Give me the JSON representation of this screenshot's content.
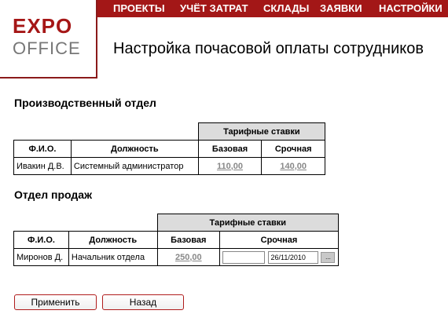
{
  "logo": {
    "line1": "EXPO",
    "line2": "OFFICE"
  },
  "nav": [
    "ПРОЕКТЫ",
    "УЧЁТ ЗАТРАТ",
    "СКЛАДЫ",
    "ЗАЯВКИ",
    "НАСТРОЙКИ"
  ],
  "page_title": "Настройка почасовой оплаты сотрудников",
  "production": {
    "title": "Производственный отдел",
    "group_header": "Тарифные ставки",
    "columns": [
      "Ф.И.О.",
      "Должность",
      "Базовая",
      "Срочная"
    ],
    "row": {
      "name": "Ивакин Д.В.",
      "position": "Системный администратор",
      "base": "110,00",
      "urgent": "140,00"
    }
  },
  "sales": {
    "title": "Отдел продаж",
    "group_header": "Тарифные ставки",
    "columns": [
      "Ф.И.О.",
      "Должность",
      "Базовая",
      "Срочная"
    ],
    "row": {
      "name": "Миронов Д.",
      "position": "Начальник отдела",
      "base": "250,00",
      "urgent_value": "",
      "urgent_date": "26/11/2010",
      "picker": "..."
    }
  },
  "buttons": {
    "apply": "Применить",
    "back": "Назад"
  },
  "colors": {
    "brand": "#a31717",
    "header_bg": "#dcdcdc",
    "link": "#888888"
  }
}
